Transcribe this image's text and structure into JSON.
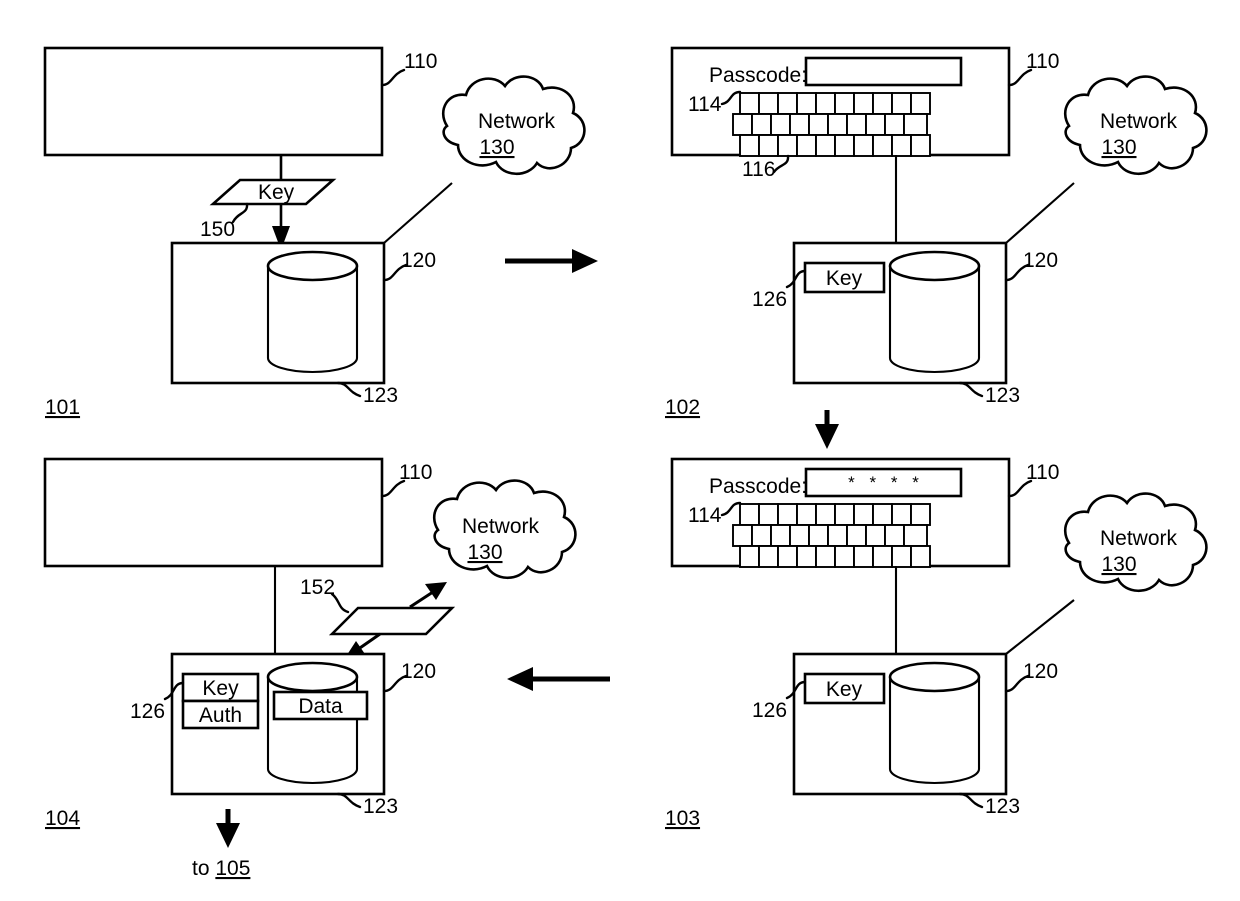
{
  "figure": {
    "type": "patent-diagram",
    "background_color": "#ffffff",
    "line_color": "#000000"
  },
  "panels": [
    {
      "id": "panel-101",
      "label": "101",
      "device_ref": "110",
      "storage_ref": "120",
      "cylinder_ref": "123",
      "network_label": "Network",
      "network_ref": "130",
      "key_token_label": "Key",
      "key_token_ref": "150"
    },
    {
      "id": "panel-102",
      "label": "102",
      "device_ref": "110",
      "passcode_label": "Passcode:",
      "passcode_value": "",
      "keyboard_ref_top": "114",
      "keyboard_ref_bottom": "116",
      "storage_ref": "120",
      "cylinder_ref": "123",
      "key_box_label": "Key",
      "key_box_ref": "126",
      "network_label": "Network",
      "network_ref": "130"
    },
    {
      "id": "panel-103",
      "label": "103",
      "device_ref": "110",
      "passcode_label": "Passcode:",
      "passcode_value": "* * * *",
      "keyboard_ref_top": "114",
      "storage_ref": "120",
      "cylinder_ref": "123",
      "key_box_label": "Key",
      "key_box_ref": "126",
      "network_label": "Network",
      "network_ref": "130"
    },
    {
      "id": "panel-104",
      "label": "104",
      "device_ref": "110",
      "storage_ref": "120",
      "cylinder_ref": "123",
      "key_box_label": "Key",
      "auth_box_label": "Auth",
      "key_box_ref": "126",
      "data_label": "Data",
      "network_label": "Network",
      "network_ref": "130",
      "token_ref": "152",
      "exit_text_prefix": "to ",
      "exit_text_ref": "105"
    }
  ],
  "flow_arrows": [
    {
      "name": "arrow-101-to-102",
      "direction": "right"
    },
    {
      "name": "arrow-102-to-103",
      "direction": "down"
    },
    {
      "name": "arrow-103-to-104",
      "direction": "left"
    },
    {
      "name": "arrow-104-to-105",
      "direction": "down"
    }
  ],
  "keyboard": {
    "rows": 3,
    "keys_per_row": 10
  }
}
